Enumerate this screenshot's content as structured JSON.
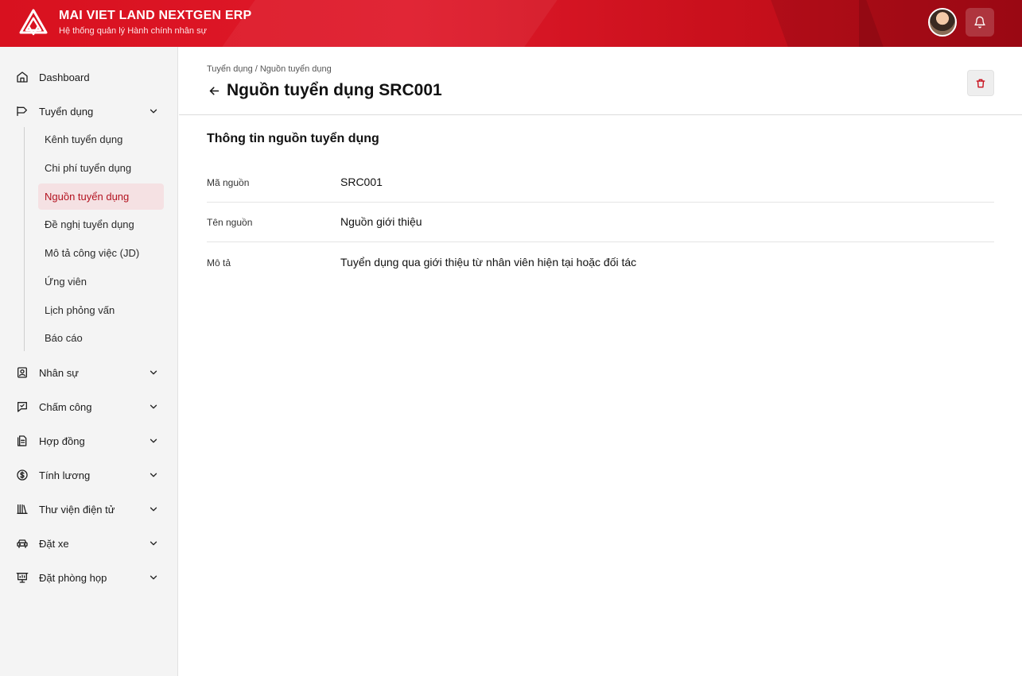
{
  "header": {
    "brand_title": "MAI VIET LAND NEXTGEN ERP",
    "brand_subtitle": "Hệ thống quản lý Hành chính nhân sự",
    "accent": "#d8111f"
  },
  "sidebar": {
    "items": [
      {
        "label": "Dashboard",
        "icon": "home-icon"
      },
      {
        "label": "Tuyển dụng",
        "icon": "megaphone-icon",
        "expanded": true
      },
      {
        "label": "Nhân sự",
        "icon": "id-badge-icon"
      },
      {
        "label": "Chấm công",
        "icon": "timesheet-icon"
      },
      {
        "label": "Hợp đồng",
        "icon": "contract-icon"
      },
      {
        "label": "Tính lương",
        "icon": "dollar-icon"
      },
      {
        "label": "Thư viện điện tử",
        "icon": "library-icon"
      },
      {
        "label": "Đặt xe",
        "icon": "car-icon"
      },
      {
        "label": "Đặt phòng họp",
        "icon": "presentation-icon"
      }
    ],
    "sub_items": [
      {
        "label": "Kênh tuyển dụng",
        "active": false
      },
      {
        "label": "Chi phí tuyển dụng",
        "active": false
      },
      {
        "label": "Nguồn tuyển dụng",
        "active": true
      },
      {
        "label": "Đề nghị tuyển dụng",
        "active": false
      },
      {
        "label": "Mô tả công việc (JD)",
        "active": false
      },
      {
        "label": "Ứng viên",
        "active": false
      },
      {
        "label": "Lịch phỏng vấn",
        "active": false
      },
      {
        "label": "Báo cáo",
        "active": false
      }
    ]
  },
  "main": {
    "breadcrumb": "Tuyển dụng / Nguồn tuyển dụng",
    "title": "Nguồn tuyển dụng SRC001",
    "section_title": "Thông tin nguồn tuyển dụng",
    "fields": [
      {
        "label": "Mã nguồn",
        "value": "SRC001"
      },
      {
        "label": "Tên nguồn",
        "value": "Nguồn giới thiệu"
      },
      {
        "label": "Mô tả",
        "value": "Tuyển dụng qua giới thiệu từ nhân viên hiện tại hoặc đối tác"
      }
    ]
  }
}
